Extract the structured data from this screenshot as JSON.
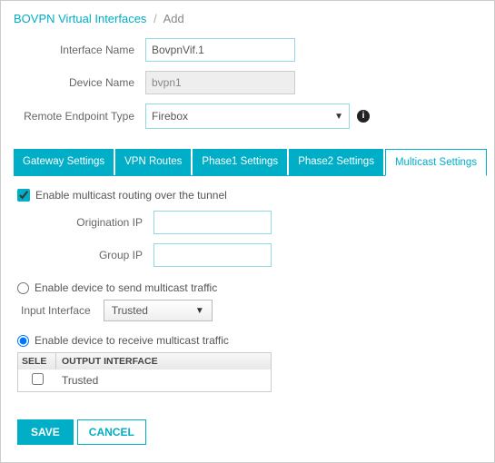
{
  "breadcrumb": {
    "parent": "BOVPN Virtual Interfaces",
    "current": "Add"
  },
  "form": {
    "interface_name_label": "Interface Name",
    "interface_name_value": "BovpnVif.1",
    "device_name_label": "Device Name",
    "device_name_value": "bvpn1",
    "remote_endpoint_label": "Remote Endpoint Type",
    "remote_endpoint_value": "Firebox"
  },
  "tabs": {
    "gateway": "Gateway Settings",
    "vpn_routes": "VPN Routes",
    "phase1": "Phase1 Settings",
    "phase2": "Phase2 Settings",
    "multicast": "Multicast Settings"
  },
  "multicast": {
    "enable_routing_label": "Enable multicast routing over the tunnel",
    "origination_ip_label": "Origination IP",
    "origination_ip_value": "",
    "group_ip_label": "Group IP",
    "group_ip_value": "",
    "radio_send_label": "Enable device to send multicast traffic",
    "input_interface_label": "Input Interface",
    "input_interface_value": "Trusted",
    "radio_receive_label": "Enable device to receive multicast traffic",
    "table": {
      "col_sele": "SELE",
      "col_output": "OUTPUT INTERFACE",
      "rows": [
        {
          "name": "Trusted"
        }
      ]
    }
  },
  "buttons": {
    "save": "SAVE",
    "cancel": "CANCEL"
  }
}
